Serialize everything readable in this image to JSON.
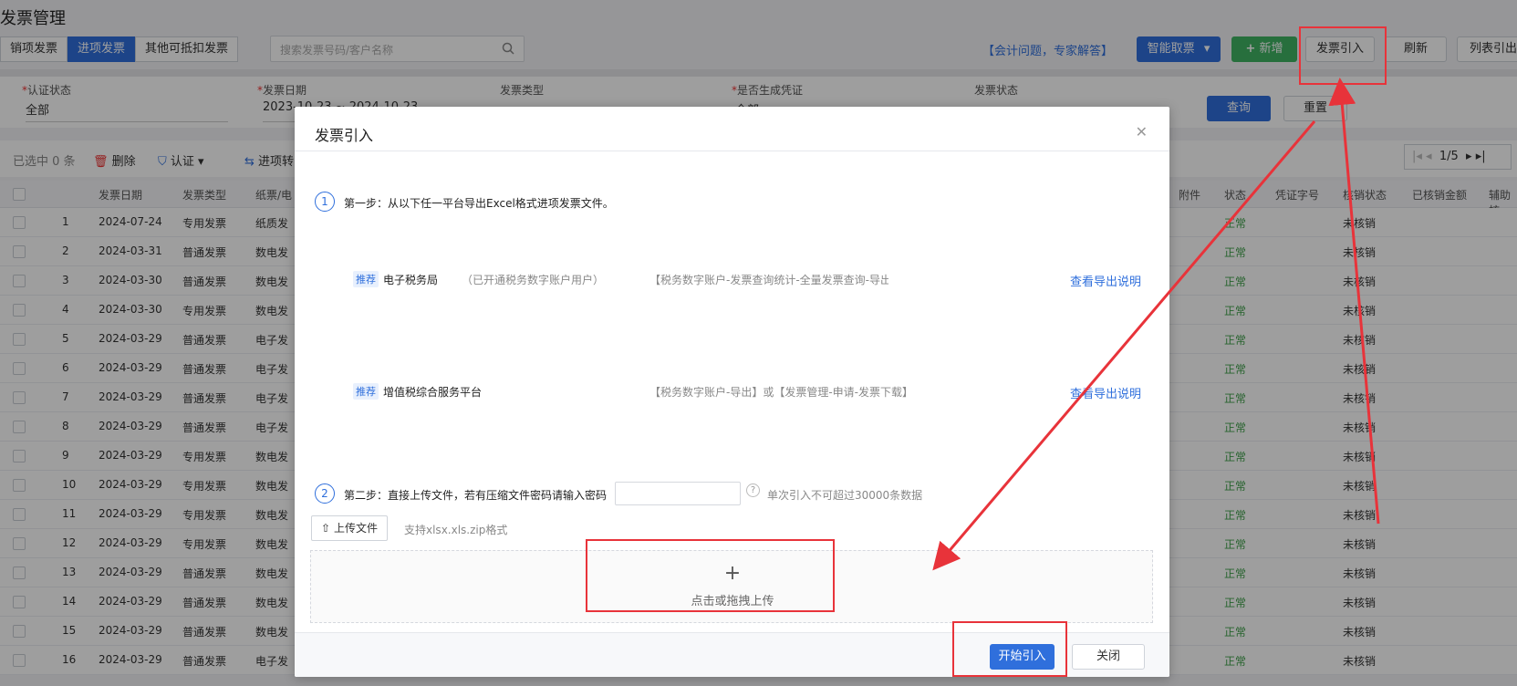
{
  "page_title": "发票管理",
  "tabs": [
    {
      "label": "销项发票",
      "active": false
    },
    {
      "label": "进项发票",
      "active": true
    },
    {
      "label": "其他可抵扣发票",
      "active": false
    }
  ],
  "search": {
    "placeholder": "搜索发票号码/客户名称"
  },
  "header_actions": {
    "consult_link": "【会计问题，专家解答】",
    "smart_fetch": "智能取票",
    "add": "新增",
    "import": "发票引入",
    "refresh": "刷新",
    "list_export": "列表引出"
  },
  "filters": {
    "cert_status_label": "认证状态",
    "cert_status_value": "全部",
    "invoice_date_label": "发票日期",
    "invoice_date_value": "2023-10-23 ~ 2024-10-23",
    "invoice_type_label": "发票类型",
    "voucher_label": "是否生成凭证",
    "voucher_value": "全部",
    "invoice_status_label": "发票状态",
    "query": "查询",
    "reset": "重置"
  },
  "toolbar": {
    "selected": "已选中 0 条",
    "delete": "删除",
    "certify": "认证",
    "import_label": "进项转",
    "pager": "1/5"
  },
  "table": {
    "headers": {
      "date": "发票日期",
      "type": "发票类型",
      "paper": "纸票/电",
      "attach": "附件",
      "status": "状态",
      "voucher": "凭证字号",
      "writeoff": "核销状态",
      "written_amt": "已核销金额",
      "aux": "辅助核"
    },
    "rows": [
      {
        "no": "1",
        "date": "2024-07-24",
        "type": "专用发票",
        "paper": "纸质发",
        "status": "正常",
        "writeoff": "未核销"
      },
      {
        "no": "2",
        "date": "2024-03-31",
        "type": "普通发票",
        "paper": "数电发",
        "status": "正常",
        "writeoff": "未核销"
      },
      {
        "no": "3",
        "date": "2024-03-30",
        "type": "普通发票",
        "paper": "数电发",
        "status": "正常",
        "writeoff": "未核销"
      },
      {
        "no": "4",
        "date": "2024-03-30",
        "type": "专用发票",
        "paper": "数电发",
        "status": "正常",
        "writeoff": "未核销"
      },
      {
        "no": "5",
        "date": "2024-03-29",
        "type": "普通发票",
        "paper": "电子发",
        "status": "正常",
        "writeoff": "未核销"
      },
      {
        "no": "6",
        "date": "2024-03-29",
        "type": "普通发票",
        "paper": "电子发",
        "status": "正常",
        "writeoff": "未核销"
      },
      {
        "no": "7",
        "date": "2024-03-29",
        "type": "普通发票",
        "paper": "电子发",
        "status": "正常",
        "writeoff": "未核销"
      },
      {
        "no": "8",
        "date": "2024-03-29",
        "type": "普通发票",
        "paper": "电子发",
        "status": "正常",
        "writeoff": "未核销"
      },
      {
        "no": "9",
        "date": "2024-03-29",
        "type": "专用发票",
        "paper": "数电发",
        "status": "正常",
        "writeoff": "未核销"
      },
      {
        "no": "10",
        "date": "2024-03-29",
        "type": "专用发票",
        "paper": "数电发",
        "status": "正常",
        "writeoff": "未核销"
      },
      {
        "no": "11",
        "date": "2024-03-29",
        "type": "专用发票",
        "paper": "数电发",
        "status": "正常",
        "writeoff": "未核销"
      },
      {
        "no": "12",
        "date": "2024-03-29",
        "type": "专用发票",
        "paper": "数电发",
        "status": "正常",
        "writeoff": "未核销"
      },
      {
        "no": "13",
        "date": "2024-03-29",
        "type": "普通发票",
        "paper": "数电发",
        "status": "正常",
        "writeoff": "未核销"
      },
      {
        "no": "14",
        "date": "2024-03-29",
        "type": "普通发票",
        "paper": "数电发",
        "status": "正常",
        "writeoff": "未核销"
      },
      {
        "no": "15",
        "date": "2024-03-29",
        "type": "普通发票",
        "paper": "数电发",
        "status": "正常",
        "writeoff": "未核销"
      },
      {
        "no": "16",
        "date": "2024-03-29",
        "type": "普通发票",
        "paper": "电子发",
        "status": "正常",
        "writeoff": "未核销"
      }
    ]
  },
  "modal": {
    "title": "发票引入",
    "step1_num": "1",
    "step1_text": "第一步：从以下任一平台导出Excel格式进项发票文件。",
    "platforms": [
      {
        "tag": "推荐",
        "name": "电子税务局",
        "note": "（已开通税务数字账户用户）",
        "path": "【税务数字账户-发票查询统计-全量发票查询-导出全部",
        "link": "查看导出说明"
      },
      {
        "tag": "推荐",
        "name": "增值税综合服务平台",
        "note": "",
        "path": "【税务数字账户-导出】或【发票管理-申请-发票下载】",
        "link": "查看导出说明"
      }
    ],
    "step2_num": "2",
    "step2_text": "第二步：直接上传文件，若有压缩文件密码请输入密码",
    "help": "?",
    "limit_note": "单次引入不可超过30000条数据",
    "upload_btn": "上传文件",
    "upload_hint": "支持xlsx.xls.zip格式",
    "drop_plus": "+",
    "drop_text": "点击或拖拽上传",
    "start_btn": "开始引入",
    "close_btn": "关闭"
  },
  "colors": {
    "accent": "#2f6fdc",
    "green": "#3fb463",
    "annotation": "#e8333a"
  }
}
